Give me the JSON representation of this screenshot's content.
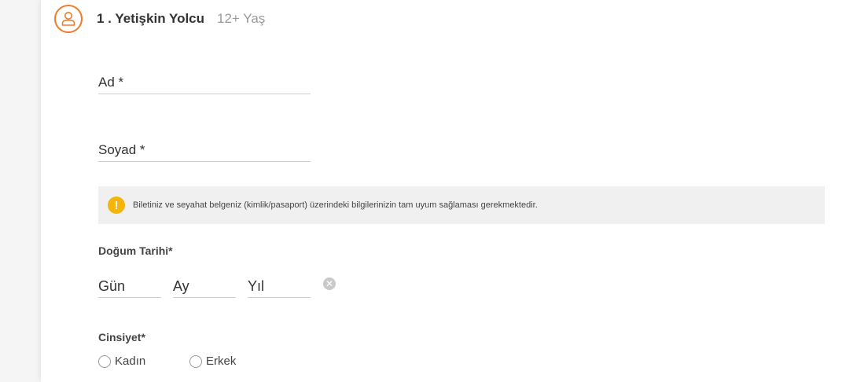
{
  "passenger": {
    "title": "1 . Yetişkin Yolcu",
    "age_group": "12+ Yaş",
    "icon": "user-icon",
    "accent_color": "#f07c2a"
  },
  "fields": {
    "first_name_label": "Ad *",
    "last_name_label": "Soyad *"
  },
  "info": {
    "icon": "info-icon",
    "text": "Biletiniz ve seyahat belgeniz (kimlik/pasaport) üzerindeki bilgilerinizin tam uyum sağlaması gerekmektedir."
  },
  "birth_date": {
    "label": "Doğum Tarihi*",
    "day_label": "Gün",
    "month_label": "Ay",
    "year_label": "Yıl"
  },
  "gender": {
    "label": "Cinsiyet*",
    "options": [
      "Kadın",
      "Erkek"
    ]
  }
}
